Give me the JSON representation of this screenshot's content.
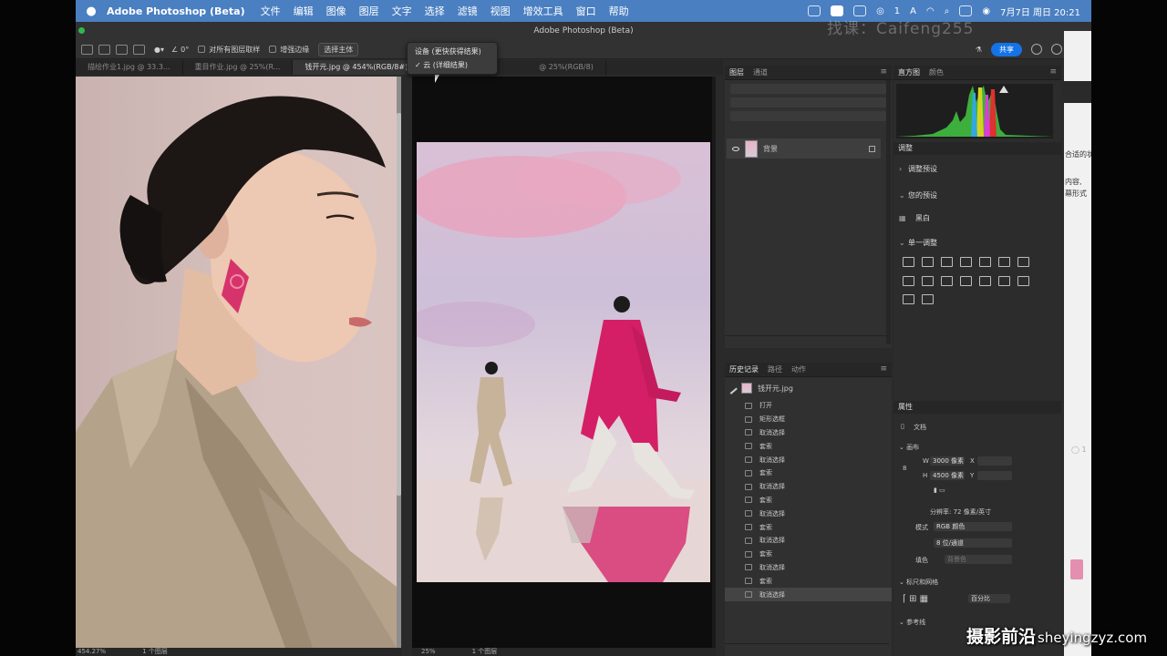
{
  "menubar": {
    "app_name": "Adobe Photoshop (Beta)",
    "items": [
      "文件",
      "编辑",
      "图像",
      "图层",
      "文字",
      "选择",
      "滤镜",
      "视图",
      "增效工具",
      "窗口",
      "帮助"
    ],
    "status_count": "1",
    "input_method": "A",
    "datetime": "7月7日 周日 20:21"
  },
  "window": {
    "title": "Adobe Photoshop (Beta)",
    "watermark": "找课：Caifeng255"
  },
  "options_bar": {
    "angle": "0°",
    "sample_all_layers": "对所有图层取样",
    "enhance_edge": "增强边缘",
    "select_subject": "选择主体",
    "share": "共享"
  },
  "select_subject_menu": {
    "items": [
      "设备 (更快获得结果)",
      "✓ 云 (详细结果)"
    ]
  },
  "tabs": [
    {
      "label": "描绘作业1.jpg @ 33.3...",
      "active": false
    },
    {
      "label": "重目作业.jpg @ 25%(R...",
      "active": false
    },
    {
      "label": "钱开元.jpg @ 454%(RGB/8#)",
      "active": true
    },
    {
      "label": "@ 25%(RGB/8)",
      "active": false
    }
  ],
  "status": {
    "left_zoom": "454.27%",
    "left_layers": "1 个图层",
    "right_zoom": "25%",
    "right_layers": "1 个图层"
  },
  "layers_panel": {
    "tabs": [
      "图层",
      "通道"
    ],
    "layer_name": "背景"
  },
  "history_panel": {
    "tabs": [
      "历史记录",
      "路径",
      "动作"
    ],
    "snapshot": "钱开元.jpg",
    "items": [
      "打开",
      "矩形选框",
      "取消选择",
      "套索",
      "取消选择",
      "套索",
      "取消选择",
      "套索",
      "取消选择",
      "套索",
      "取消选择",
      "套索",
      "取消选择",
      "套索",
      "取消选择"
    ],
    "selected_index": 14
  },
  "right_panels": {
    "histogram_tabs": [
      "直方图",
      "颜色"
    ],
    "adjustments_title": "调整",
    "adjust_presets": "调整预设",
    "your_presets": "您的预设",
    "preset_item": "黑白",
    "single_adjust": "单一调整",
    "properties_title": "属性",
    "doc_label": "文档",
    "canvas_section": "画布",
    "width_label": "W",
    "width_value": "3000 像素",
    "x_label": "X",
    "height_label": "H",
    "height_value": "4500 像素",
    "y_label": "Y",
    "resolution": "分辨率: 72 像素/英寸",
    "mode_label": "模式",
    "mode_value": "RGB 颜色",
    "depth_value": "8 位/通道",
    "fill_label": "填色",
    "fill_value": "背景色",
    "rulers_section": "标尺和网格",
    "ruler_unit": "百分比",
    "guides_section": "参考线"
  },
  "side_window": {
    "texts": [
      "合适的状",
      "内容,",
      "幕形式",
      "◯ 1"
    ]
  },
  "corner_watermark": {
    "cn": "摄影前沿",
    "en": "sheyingzyz.com"
  }
}
